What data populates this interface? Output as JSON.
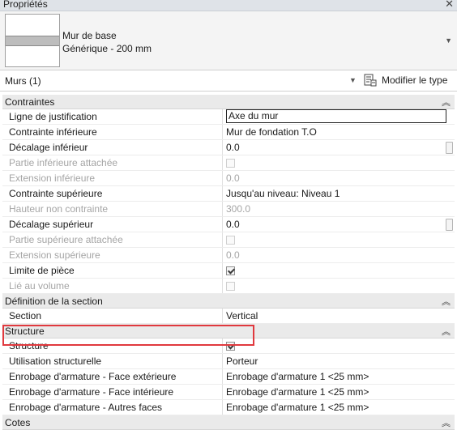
{
  "panel": {
    "title": "Propriétés"
  },
  "type_selector": {
    "family": "Mur de base",
    "type": "Générique - 200 mm"
  },
  "filter": {
    "label": "Murs (1)",
    "edit_type": "Modifier le type"
  },
  "groups": {
    "contraintes": "Contraintes",
    "section": "Définition de la section",
    "structure": "Structure",
    "cotes": "Cotes"
  },
  "rows": {
    "r1": {
      "name": "Ligne de justification",
      "value": "Axe du mur"
    },
    "r2": {
      "name": "Contrainte inférieure",
      "value": "Mur de fondation T.O"
    },
    "r3": {
      "name": "Décalage inférieur",
      "value": "0.0"
    },
    "r4": {
      "name": "Partie inférieure attachée"
    },
    "r5": {
      "name": "Extension inférieure",
      "value": "0.0"
    },
    "r6": {
      "name": "Contrainte supérieure",
      "value": "Jusqu'au niveau: Niveau 1"
    },
    "r7": {
      "name": "Hauteur non contrainte",
      "value": "300.0"
    },
    "r8": {
      "name": "Décalage supérieur",
      "value": "0.0"
    },
    "r9": {
      "name": "Partie supérieure attachée"
    },
    "r10": {
      "name": "Extension supérieure",
      "value": "0.0"
    },
    "r11": {
      "name": "Limite de pièce"
    },
    "r12": {
      "name": "Lié au volume"
    },
    "r13": {
      "name": "Section",
      "value": "Vertical"
    },
    "r14": {
      "name": "Structure"
    },
    "r15": {
      "name": "Utilisation structurelle",
      "value": "Porteur"
    },
    "r16": {
      "name": "Enrobage d'armature - Face extérieure",
      "value": "Enrobage d'armature 1 <25 mm>"
    },
    "r17": {
      "name": "Enrobage d'armature - Face intérieure",
      "value": "Enrobage d'armature 1 <25 mm>"
    },
    "r18": {
      "name": "Enrobage d'armature - Autres faces",
      "value": "Enrobage d'armature 1 <25 mm>"
    }
  },
  "icons": {
    "close": "close-icon",
    "collapse": "double-chevron-up-icon",
    "dropdown": "chevron-down-icon",
    "edit_type": "edit-type-icon"
  },
  "colors": {
    "highlight": "#e0393e"
  }
}
